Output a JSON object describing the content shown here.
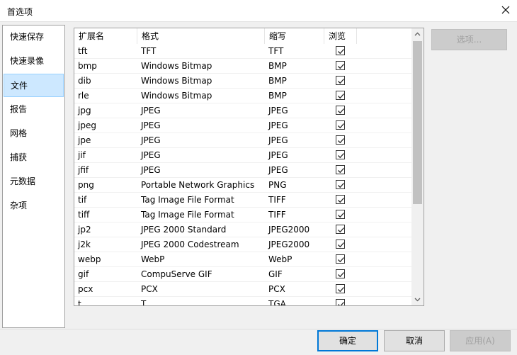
{
  "window": {
    "title": "首选项"
  },
  "sidebar": {
    "items": [
      {
        "label": "快速保存",
        "selected": false
      },
      {
        "label": "快速录像",
        "selected": false
      },
      {
        "label": "文件",
        "selected": true
      },
      {
        "label": "报告",
        "selected": false
      },
      {
        "label": "网格",
        "selected": false
      },
      {
        "label": "捕获",
        "selected": false
      },
      {
        "label": "元数据",
        "selected": false
      },
      {
        "label": "杂项",
        "selected": false
      }
    ]
  },
  "table": {
    "headers": {
      "ext": "扩展名",
      "format": "格式",
      "abbr": "缩写",
      "browse": "浏览"
    },
    "rows": [
      {
        "ext": "tft",
        "format": "TFT",
        "abbr": "TFT",
        "browse": true
      },
      {
        "ext": "bmp",
        "format": "Windows Bitmap",
        "abbr": "BMP",
        "browse": true
      },
      {
        "ext": "dib",
        "format": "Windows Bitmap",
        "abbr": "BMP",
        "browse": true
      },
      {
        "ext": "rle",
        "format": "Windows Bitmap",
        "abbr": "BMP",
        "browse": true
      },
      {
        "ext": "jpg",
        "format": "JPEG",
        "abbr": "JPEG",
        "browse": true
      },
      {
        "ext": "jpeg",
        "format": "JPEG",
        "abbr": "JPEG",
        "browse": true
      },
      {
        "ext": "jpe",
        "format": "JPEG",
        "abbr": "JPEG",
        "browse": true
      },
      {
        "ext": "jif",
        "format": "JPEG",
        "abbr": "JPEG",
        "browse": true
      },
      {
        "ext": "jfif",
        "format": "JPEG",
        "abbr": "JPEG",
        "browse": true
      },
      {
        "ext": "png",
        "format": "Portable Network Graphics",
        "abbr": "PNG",
        "browse": true
      },
      {
        "ext": "tif",
        "format": "Tag Image File Format",
        "abbr": "TIFF",
        "browse": true
      },
      {
        "ext": "tiff",
        "format": "Tag Image File Format",
        "abbr": "TIFF",
        "browse": true
      },
      {
        "ext": "jp2",
        "format": "JPEG 2000 Standard",
        "abbr": "JPEG2000",
        "browse": true
      },
      {
        "ext": "j2k",
        "format": "JPEG 2000 Codestream",
        "abbr": "JPEG2000",
        "browse": true
      },
      {
        "ext": "webp",
        "format": "WebP",
        "abbr": "WebP",
        "browse": true
      },
      {
        "ext": "gif",
        "format": "CompuServe GIF",
        "abbr": "GIF",
        "browse": true
      },
      {
        "ext": "pcx",
        "format": "PCX",
        "abbr": "PCX",
        "browse": true
      },
      {
        "ext": "t",
        "format": "T",
        "abbr": "TGA",
        "browse": true
      }
    ]
  },
  "buttons": {
    "options": "选项...",
    "ok": "确定",
    "cancel": "取消",
    "apply": "应用(A)"
  },
  "icons": {
    "close": "close-icon",
    "scroll_up": "chevron-up-icon",
    "scroll_down": "chevron-down-icon",
    "checkbox": "checkmark-icon"
  },
  "colors": {
    "selection_bg": "#cde8ff",
    "selection_border": "#99d1ff",
    "default_button_border": "#0078d7"
  }
}
